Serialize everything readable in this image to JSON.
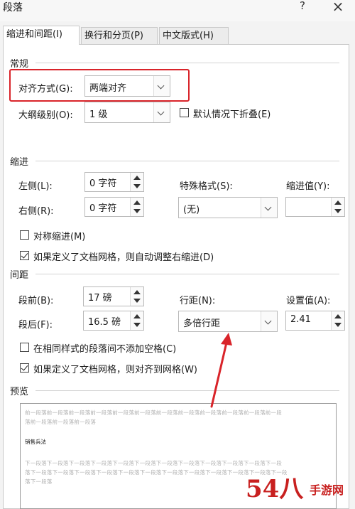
{
  "window": {
    "title": "段落",
    "help": "?",
    "close": "×"
  },
  "tabs": [
    {
      "label": "缩进和间距(I)"
    },
    {
      "label": "换行和分页(P)"
    },
    {
      "label": "中文版式(H)"
    }
  ],
  "general": {
    "heading": "常规",
    "alignment_label": "对齐方式(G):",
    "alignment_value": "两端对齐",
    "outline_label": "大纲级别(O):",
    "outline_value": "1 级",
    "collapse_label": "默认情况下折叠(E)"
  },
  "indent": {
    "heading": "缩进",
    "left_label": "左侧(L):",
    "left_value": "0 字符",
    "right_label": "右侧(R):",
    "right_value": "0 字符",
    "special_label": "特殊格式(S):",
    "special_value": "(无)",
    "indent_by_label": "缩进值(Y):",
    "indent_by_value": "",
    "mirror_label": "对称缩进(M)",
    "auto_adjust_label": "如果定义了文档网格，则自动调整右缩进(D)"
  },
  "spacing": {
    "heading": "间距",
    "before_label": "段前(B):",
    "before_value": "17 磅",
    "after_label": "段后(F):",
    "after_value": "16.5 磅",
    "line_label": "行距(N):",
    "line_value": "多倍行距",
    "at_label": "设置值(A):",
    "at_value": "2.41",
    "no_space_same_style_label": "在相同样式的段落间不添加空格(C)",
    "snap_grid_label": "如果定义了文档网格，则对齐到网格(W)"
  },
  "preview": {
    "heading": "预览",
    "prev_line_1": "前一段落前一段落前一段落前一段落前一段落前一段落前一段落前一段落前一段落前一段落前一段落前一段",
    "prev_line_2": "落前一段落前一段落前一段落",
    "sample": "销售兵法",
    "next_line_1": "下一段落下一段落下一段落下一段落下一段落下一段落下一段落下一段落下一段落下一段落下一段落下一段",
    "next_line_2": "落下一段落下一段落下一段落下一段落下一段落下一段落下一段落下一段落下一段落下一段落下一段落下一段",
    "next_line_3": "落下一段落"
  },
  "annotation_color": "#d9242a",
  "watermark": {
    "text": "54八",
    "text_cn": "手游网"
  }
}
